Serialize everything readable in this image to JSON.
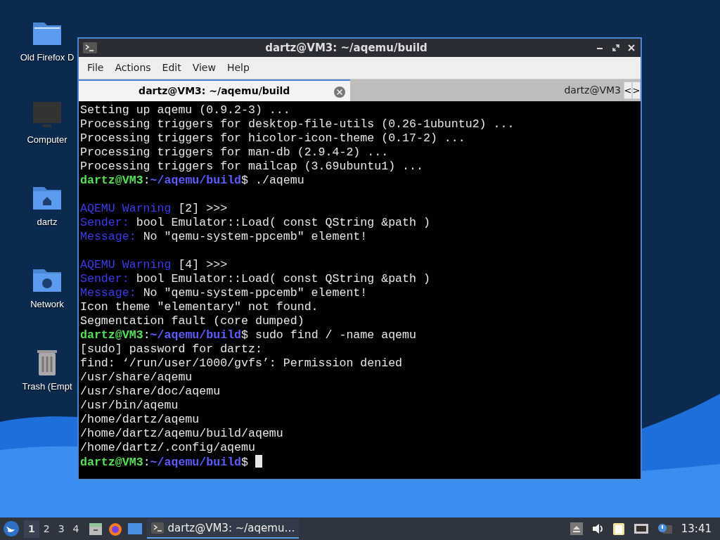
{
  "desktop_icons": [
    {
      "label": "Old Firefox D",
      "kind": "folder"
    },
    {
      "label": "Computer",
      "kind": "monitor"
    },
    {
      "label": "dartz",
      "kind": "home"
    },
    {
      "label": "Network",
      "kind": "network"
    },
    {
      "label": "Trash (Empt",
      "kind": "trash"
    }
  ],
  "window": {
    "title": "dartz@VM3: ~/aqemu/build",
    "menu": [
      "File",
      "Actions",
      "Edit",
      "View",
      "Help"
    ],
    "tabs": [
      {
        "label": "dartz@VM3: ~/aqemu/build",
        "selected": true
      },
      {
        "label": "dartz@VM3",
        "selected": false
      }
    ],
    "tab_scroll": [
      "<",
      ">"
    ],
    "terminal": {
      "cursor": true,
      "lines": [
        {
          "spans": [
            {
              "kind": "text",
              "text": "Setting up aqemu (0.9.2-3) ..."
            }
          ]
        },
        {
          "spans": [
            {
              "kind": "text",
              "text": "Processing triggers for desktop-file-utils (0.26-1ubuntu2) ..."
            }
          ]
        },
        {
          "spans": [
            {
              "kind": "text",
              "text": "Processing triggers for hicolor-icon-theme (0.17-2) ..."
            }
          ]
        },
        {
          "spans": [
            {
              "kind": "text",
              "text": "Processing triggers for man-db (2.9.4-2) ..."
            }
          ]
        },
        {
          "spans": [
            {
              "kind": "text",
              "text": "Processing triggers for mailcap (3.69ubuntu1) ..."
            }
          ]
        },
        {
          "spans": [
            {
              "kind": "user",
              "text": "dartz@VM3"
            },
            {
              "kind": "text",
              "text": ":"
            },
            {
              "kind": "path",
              "text": "~/aqemu/build"
            },
            {
              "kind": "text",
              "text": "$ ./aqemu"
            }
          ]
        },
        {
          "blank_before": true,
          "spans": [
            {
              "kind": "label",
              "text": "AQEMU Warning"
            },
            {
              "kind": "text",
              "text": " [2] >>>"
            }
          ]
        },
        {
          "spans": [
            {
              "kind": "label",
              "text": "Sender:"
            },
            {
              "kind": "text",
              "text": " bool Emulator::Load( const QString &path )"
            }
          ]
        },
        {
          "spans": [
            {
              "kind": "label",
              "text": "Message:"
            },
            {
              "kind": "text",
              "text": " No \"qemu-system-ppcemb\" element!"
            }
          ]
        },
        {
          "blank_before": true,
          "spans": [
            {
              "kind": "label",
              "text": "AQEMU Warning"
            },
            {
              "kind": "text",
              "text": " [4] >>>"
            }
          ]
        },
        {
          "spans": [
            {
              "kind": "label",
              "text": "Sender:"
            },
            {
              "kind": "text",
              "text": " bool Emulator::Load( const QString &path )"
            }
          ]
        },
        {
          "spans": [
            {
              "kind": "label",
              "text": "Message:"
            },
            {
              "kind": "text",
              "text": " No \"qemu-system-ppcemb\" element!"
            }
          ]
        },
        {
          "spans": [
            {
              "kind": "text",
              "text": "Icon theme \"elementary\" not found."
            }
          ]
        },
        {
          "spans": [
            {
              "kind": "text",
              "text": "Segmentation fault (core dumped)"
            }
          ]
        },
        {
          "spans": [
            {
              "kind": "user",
              "text": "dartz@VM3"
            },
            {
              "kind": "text",
              "text": ":"
            },
            {
              "kind": "path",
              "text": "~/aqemu/build"
            },
            {
              "kind": "text",
              "text": "$ sudo find / -name aqemu"
            }
          ]
        },
        {
          "spans": [
            {
              "kind": "text",
              "text": "[sudo] password for dartz:"
            }
          ]
        },
        {
          "spans": [
            {
              "kind": "text",
              "text": "find: ‘/run/user/1000/gvfs’: Permission denied"
            }
          ]
        },
        {
          "spans": [
            {
              "kind": "text",
              "text": "/usr/share/aqemu"
            }
          ]
        },
        {
          "spans": [
            {
              "kind": "text",
              "text": "/usr/share/doc/aqemu"
            }
          ]
        },
        {
          "spans": [
            {
              "kind": "text",
              "text": "/usr/bin/aqemu"
            }
          ]
        },
        {
          "spans": [
            {
              "kind": "text",
              "text": "/home/dartz/aqemu"
            }
          ]
        },
        {
          "spans": [
            {
              "kind": "text",
              "text": "/home/dartz/aqemu/build/aqemu"
            }
          ]
        },
        {
          "spans": [
            {
              "kind": "text",
              "text": "/home/dartz/.config/aqemu"
            }
          ]
        },
        {
          "spans": [
            {
              "kind": "user",
              "text": "dartz@VM3"
            },
            {
              "kind": "text",
              "text": ":"
            },
            {
              "kind": "path",
              "text": "~/aqemu/build"
            },
            {
              "kind": "text",
              "text": "$"
            }
          ]
        }
      ]
    }
  },
  "taskbar": {
    "workspaces": [
      {
        "label": "1",
        "selected": true
      },
      {
        "label": "2",
        "selected": false
      },
      {
        "label": "3",
        "selected": false
      },
      {
        "label": "4",
        "selected": false
      }
    ],
    "tasks": [
      {
        "label": "dartz@VM3: ~/aqemu…",
        "selected": true
      }
    ],
    "clock": "13:41"
  }
}
